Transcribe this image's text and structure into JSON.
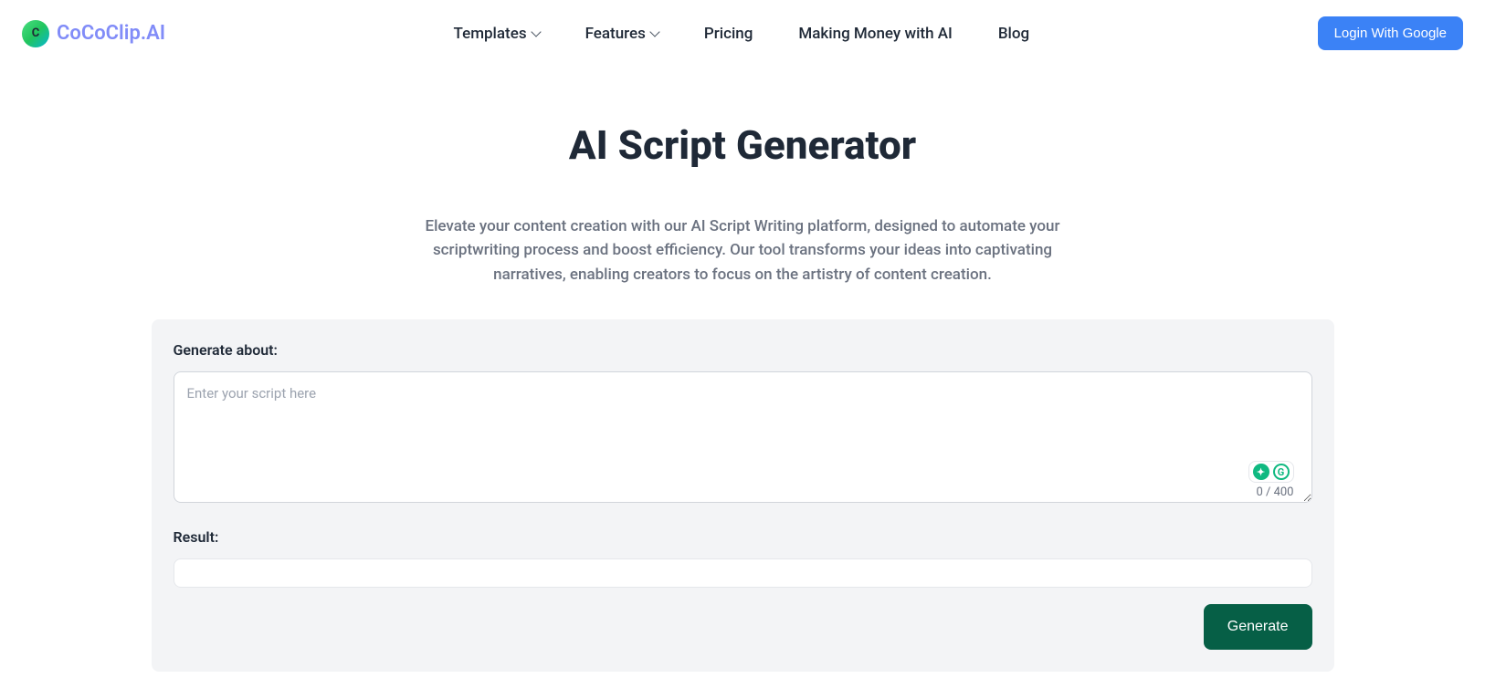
{
  "header": {
    "logo_letter": "C",
    "logo_text": "CoCoClip.AI",
    "nav": {
      "templates": "Templates",
      "features": "Features",
      "pricing": "Pricing",
      "making_money": "Making Money with AI",
      "blog": "Blog"
    },
    "login_button": "Login With Google"
  },
  "main": {
    "title": "AI Script Generator",
    "subtitle": "Elevate your content creation with our AI Script Writing platform, designed to automate your scriptwriting process and boost efficiency. Our tool transforms your ideas into captivating narratives, enabling creators to focus on the artistry of content creation."
  },
  "form": {
    "generate_label": "Generate about:",
    "input_placeholder": "Enter your script here",
    "counter": "0 / 400",
    "result_label": "Result:",
    "generate_button": "Generate"
  }
}
